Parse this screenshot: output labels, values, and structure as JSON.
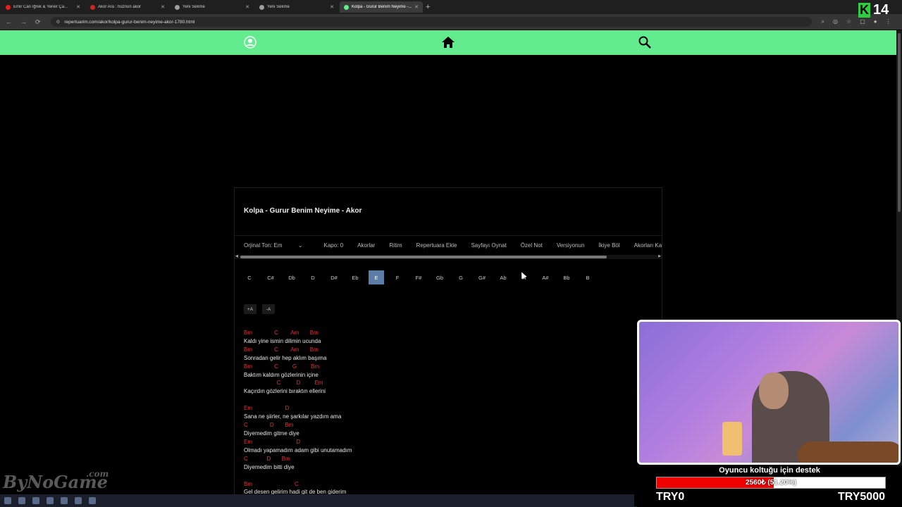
{
  "browser": {
    "tabs": [
      {
        "title": "Emir Can İğrek & Yener Ça...",
        "active": false,
        "fav_color": "#e62117"
      },
      {
        "title": "Akor Ara : hüznün akor",
        "active": false,
        "fav_color": "#c62828"
      },
      {
        "title": "Yeni Sekme",
        "active": false,
        "fav_color": "#9e9e9e"
      },
      {
        "title": "Yeni Sekme",
        "active": false,
        "fav_color": "#9e9e9e"
      },
      {
        "title": "Kolpa - Gurur Benim Neyime -...",
        "active": true,
        "fav_color": "#62ec8e"
      }
    ],
    "new_tab_symbol": "+",
    "url": "repertuarim.com/akor/kolpa-gurur-benim-neyime-akor-1780.html"
  },
  "site": {
    "accent": "#62ec8e",
    "icons": [
      "user-icon",
      "home-icon",
      "search-icon"
    ]
  },
  "song": {
    "title": "Kolpa - Gurur Benim Neyime - Akor",
    "toolbar": {
      "original_key": "Orjinal Ton: Em",
      "capo": "Kapo: 0",
      "items": [
        "Akorlar",
        "Ritim",
        "Repertuara Ekle",
        "Sayfayı Oynat",
        "Özel Not",
        "Versiyonun",
        "İkiye Böl",
        "Akorları Kapat"
      ]
    },
    "keys": [
      "C",
      "C#",
      "Db",
      "D",
      "D#",
      "Eb",
      "E",
      "F",
      "F#",
      "Gb",
      "G",
      "G#",
      "Ab",
      "A",
      "A#",
      "Bb",
      "B"
    ],
    "selected_key": "E",
    "font_up": "+A",
    "font_down": "-A",
    "stanzas": [
      [
        {
          "chords": "Bm              C        Am       Bm",
          "lyric": "Kaldı yine ismin dilimin ucunda"
        },
        {
          "chords": "Bm              C        Am       Bm",
          "lyric": "Sonradan gelir hep aklım başıma"
        },
        {
          "chords": "Bm              C         G         Bm",
          "lyric": "Baktım kaldım gözlerinin içine"
        },
        {
          "chords": "                     C          D         Em",
          "lyric": "Kaçırdın gözlerini bıraktın ellerini"
        }
      ],
      [
        {
          "chords": "Em                     D",
          "lyric": "Sana ne şiirler, ne şarkılar yazdım ama"
        },
        {
          "chords": "C              D       Bm",
          "lyric": "Diyemedim gitme diye"
        },
        {
          "chords": "Em                            D",
          "lyric": "Olmadı yapamadım adam gibi unutamadım"
        },
        {
          "chords": "C            D       Bm",
          "lyric": "Diyemedim bitti diye"
        }
      ],
      [
        {
          "chords": "Bm                           C",
          "lyric": "Gel desen gelirim hadi git de ben giderim"
        }
      ]
    ]
  },
  "overlay": {
    "donation_title": "Oyuncu koltuğu için destek",
    "donation_progress": 0.512,
    "donation_text": "2560₺ (51.20%)",
    "donation_min": "TRY0",
    "donation_max": "TRY5000",
    "badge_letter": "K",
    "badge_number": "14",
    "watermark": "ByNoGame",
    "watermark_suffix": ".com"
  }
}
